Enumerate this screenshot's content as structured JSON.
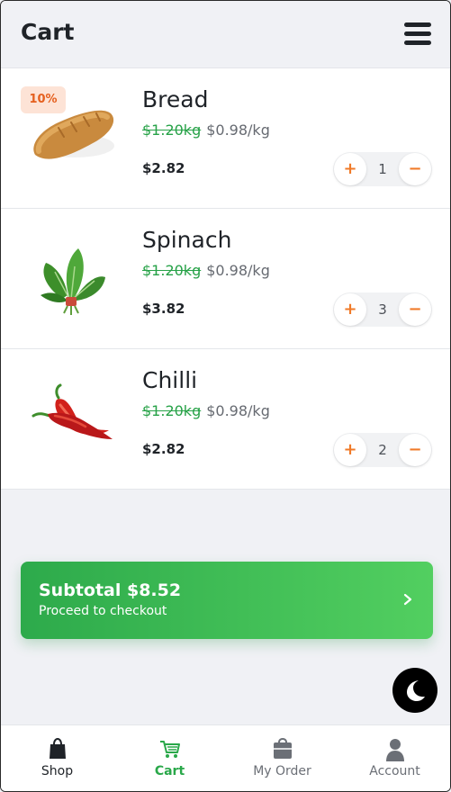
{
  "header": {
    "title": "Cart",
    "menu_icon": "hamburger-menu-icon"
  },
  "items": [
    {
      "name": "Bread",
      "badge": "10%",
      "old_price": "$1.20kg",
      "new_price": "$0.98/kg",
      "total": "$2.82",
      "quantity": "1",
      "plus": "+",
      "minus": "−",
      "image_icon": "bread-image"
    },
    {
      "name": "Spinach",
      "old_price": "$1.20kg",
      "new_price": "$0.98/kg",
      "total": "$3.82",
      "quantity": "3",
      "plus": "+",
      "minus": "−",
      "image_icon": "spinach-image"
    },
    {
      "name": "Chilli",
      "old_price": "$1.20kg",
      "new_price": "$0.98/kg",
      "total": "$2.82",
      "quantity": "2",
      "plus": "+",
      "minus": "−",
      "image_icon": "chilli-image"
    }
  ],
  "checkout": {
    "title": "Subtotal $8.52",
    "subtitle": "Proceed to checkout",
    "icon": "chevron-right-icon"
  },
  "theme_toggle": {
    "icon": "moon-icon"
  },
  "nav": [
    {
      "label": "Shop",
      "icon": "shopping-bag-icon"
    },
    {
      "label": "Cart",
      "icon": "cart-icon",
      "active": true
    },
    {
      "label": "My Order",
      "icon": "order-bag-icon"
    },
    {
      "label": "Account",
      "icon": "user-icon"
    }
  ],
  "colors": {
    "accent_green": "#2aa84a",
    "accent_orange": "#f07a28",
    "badge_bg": "#fde3d6",
    "background": "#f0f1f5"
  }
}
